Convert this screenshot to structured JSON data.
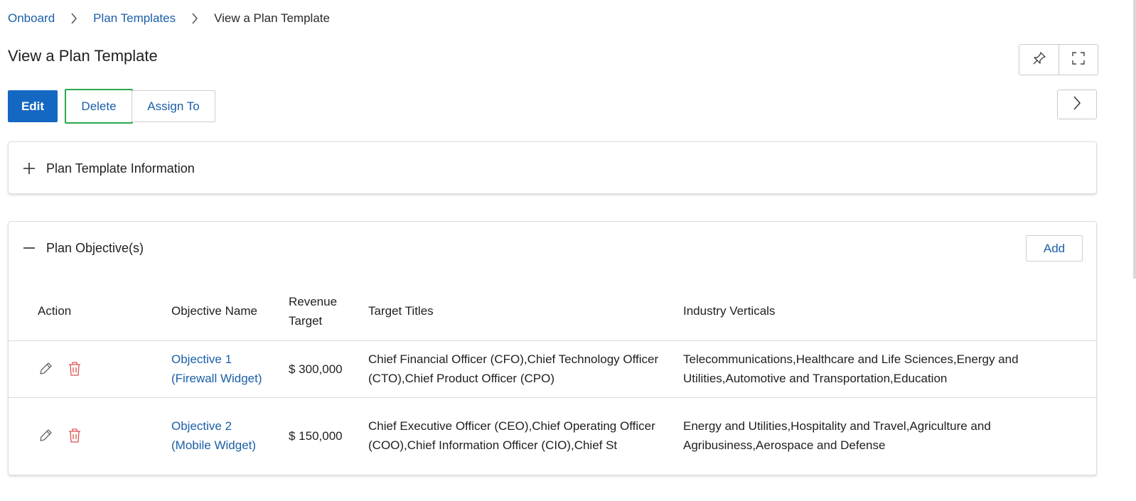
{
  "breadcrumb": {
    "items": [
      "Onboard",
      "Plan Templates"
    ],
    "current": "View a Plan Template"
  },
  "page": {
    "title": "View a Plan Template"
  },
  "toolbar": {
    "edit_label": "Edit",
    "delete_label": "Delete",
    "assign_label": "Assign To"
  },
  "sections": {
    "info_title": "Plan Template Information",
    "objectives_title": "Plan Objective(s)",
    "add_label": "Add"
  },
  "table": {
    "headers": {
      "action": "Action",
      "name": "Objective Name",
      "revenue_line1": "Revenue",
      "revenue_line2": "Target",
      "titles": "Target Titles",
      "industries": "Industry Verticals"
    },
    "rows": [
      {
        "name_line1": "Objective 1",
        "name_line2": "(Firewall Widget)",
        "revenue": "$ 300,000",
        "titles": "Chief Financial Officer (CFO),Chief Technology Officer (CTO),Chief Product Officer (CPO)",
        "industries": "Telecommunications,Healthcare and Life Sciences,Energy and Utilities,Automotive and Transportation,Education"
      },
      {
        "name_line1": "Objective 2",
        "name_line2": "(Mobile Widget)",
        "revenue": "$ 150,000",
        "titles": "Chief Executive Officer (CEO),Chief Operating Officer (COO),Chief Information Officer (CIO),Chief St",
        "industries": "Energy and Utilities,Hospitality and Travel,Agriculture and Agribusiness,Aerospace and Defense"
      }
    ]
  },
  "colors": {
    "primary": "#1468c2",
    "link": "#1a5fa8",
    "focus_outline": "#2aa84a",
    "delete_icon": "#d9534f"
  }
}
